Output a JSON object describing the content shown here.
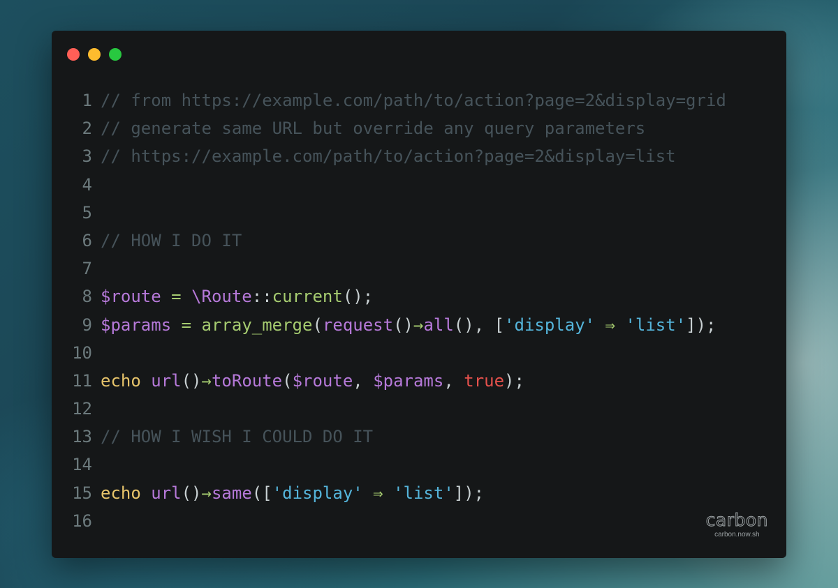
{
  "window": {
    "controls": [
      {
        "name": "close",
        "color": "#ff5f57"
      },
      {
        "name": "minimize",
        "color": "#febc2e"
      },
      {
        "name": "maximize",
        "color": "#28c840"
      }
    ]
  },
  "code": {
    "lines": [
      {
        "n": "1",
        "tokens": [
          {
            "t": "// from https://example.com/path/to/action?page=2&display=grid",
            "k": "comment"
          }
        ]
      },
      {
        "n": "2",
        "tokens": [
          {
            "t": "// generate same URL but override any query parameters",
            "k": "comment"
          }
        ]
      },
      {
        "n": "3",
        "tokens": [
          {
            "t": "// https://example.com/path/to/action?page=2&display=list",
            "k": "comment"
          }
        ]
      },
      {
        "n": "4",
        "tokens": []
      },
      {
        "n": "5",
        "tokens": []
      },
      {
        "n": "6",
        "tokens": [
          {
            "t": "// HOW I DO IT",
            "k": "comment"
          }
        ]
      },
      {
        "n": "7",
        "tokens": []
      },
      {
        "n": "8",
        "tokens": [
          {
            "t": "$route",
            "k": "var"
          },
          {
            "t": " = ",
            "k": "op"
          },
          {
            "t": "\\Route",
            "k": "var"
          },
          {
            "t": "::",
            "k": "plain"
          },
          {
            "t": "current",
            "k": "fn"
          },
          {
            "t": "();",
            "k": "plain"
          }
        ]
      },
      {
        "n": "9",
        "tokens": [
          {
            "t": "$params",
            "k": "var"
          },
          {
            "t": " = ",
            "k": "op"
          },
          {
            "t": "array_merge",
            "k": "fn"
          },
          {
            "t": "(",
            "k": "plain"
          },
          {
            "t": "request",
            "k": "var"
          },
          {
            "t": "()",
            "k": "plain"
          },
          {
            "t": "→",
            "k": "op"
          },
          {
            "t": "all",
            "k": "var"
          },
          {
            "t": "(), [",
            "k": "plain"
          },
          {
            "t": "'display'",
            "k": "str"
          },
          {
            "t": " ⇒ ",
            "k": "op"
          },
          {
            "t": "'list'",
            "k": "str"
          },
          {
            "t": "]);",
            "k": "plain"
          }
        ]
      },
      {
        "n": "10",
        "tokens": []
      },
      {
        "n": "11",
        "tokens": [
          {
            "t": "echo",
            "k": "kw"
          },
          {
            "t": " ",
            "k": "plain"
          },
          {
            "t": "url",
            "k": "var"
          },
          {
            "t": "()",
            "k": "plain"
          },
          {
            "t": "→",
            "k": "op"
          },
          {
            "t": "toRoute",
            "k": "var"
          },
          {
            "t": "(",
            "k": "plain"
          },
          {
            "t": "$route",
            "k": "var"
          },
          {
            "t": ", ",
            "k": "plain"
          },
          {
            "t": "$params",
            "k": "var"
          },
          {
            "t": ", ",
            "k": "plain"
          },
          {
            "t": "true",
            "k": "bool"
          },
          {
            "t": ");",
            "k": "plain"
          }
        ]
      },
      {
        "n": "12",
        "tokens": []
      },
      {
        "n": "13",
        "tokens": [
          {
            "t": "// HOW I WISH I COULD DO IT",
            "k": "comment"
          }
        ]
      },
      {
        "n": "14",
        "tokens": []
      },
      {
        "n": "15",
        "tokens": [
          {
            "t": "echo",
            "k": "kw"
          },
          {
            "t": " ",
            "k": "plain"
          },
          {
            "t": "url",
            "k": "var"
          },
          {
            "t": "()",
            "k": "plain"
          },
          {
            "t": "→",
            "k": "op"
          },
          {
            "t": "same",
            "k": "var"
          },
          {
            "t": "([",
            "k": "plain"
          },
          {
            "t": "'display'",
            "k": "str"
          },
          {
            "t": " ⇒ ",
            "k": "op"
          },
          {
            "t": "'list'",
            "k": "str"
          },
          {
            "t": "]);",
            "k": "plain"
          }
        ]
      },
      {
        "n": "16",
        "tokens": []
      }
    ]
  },
  "watermark": {
    "title": "carbon",
    "subtitle": "carbon.now.sh"
  }
}
